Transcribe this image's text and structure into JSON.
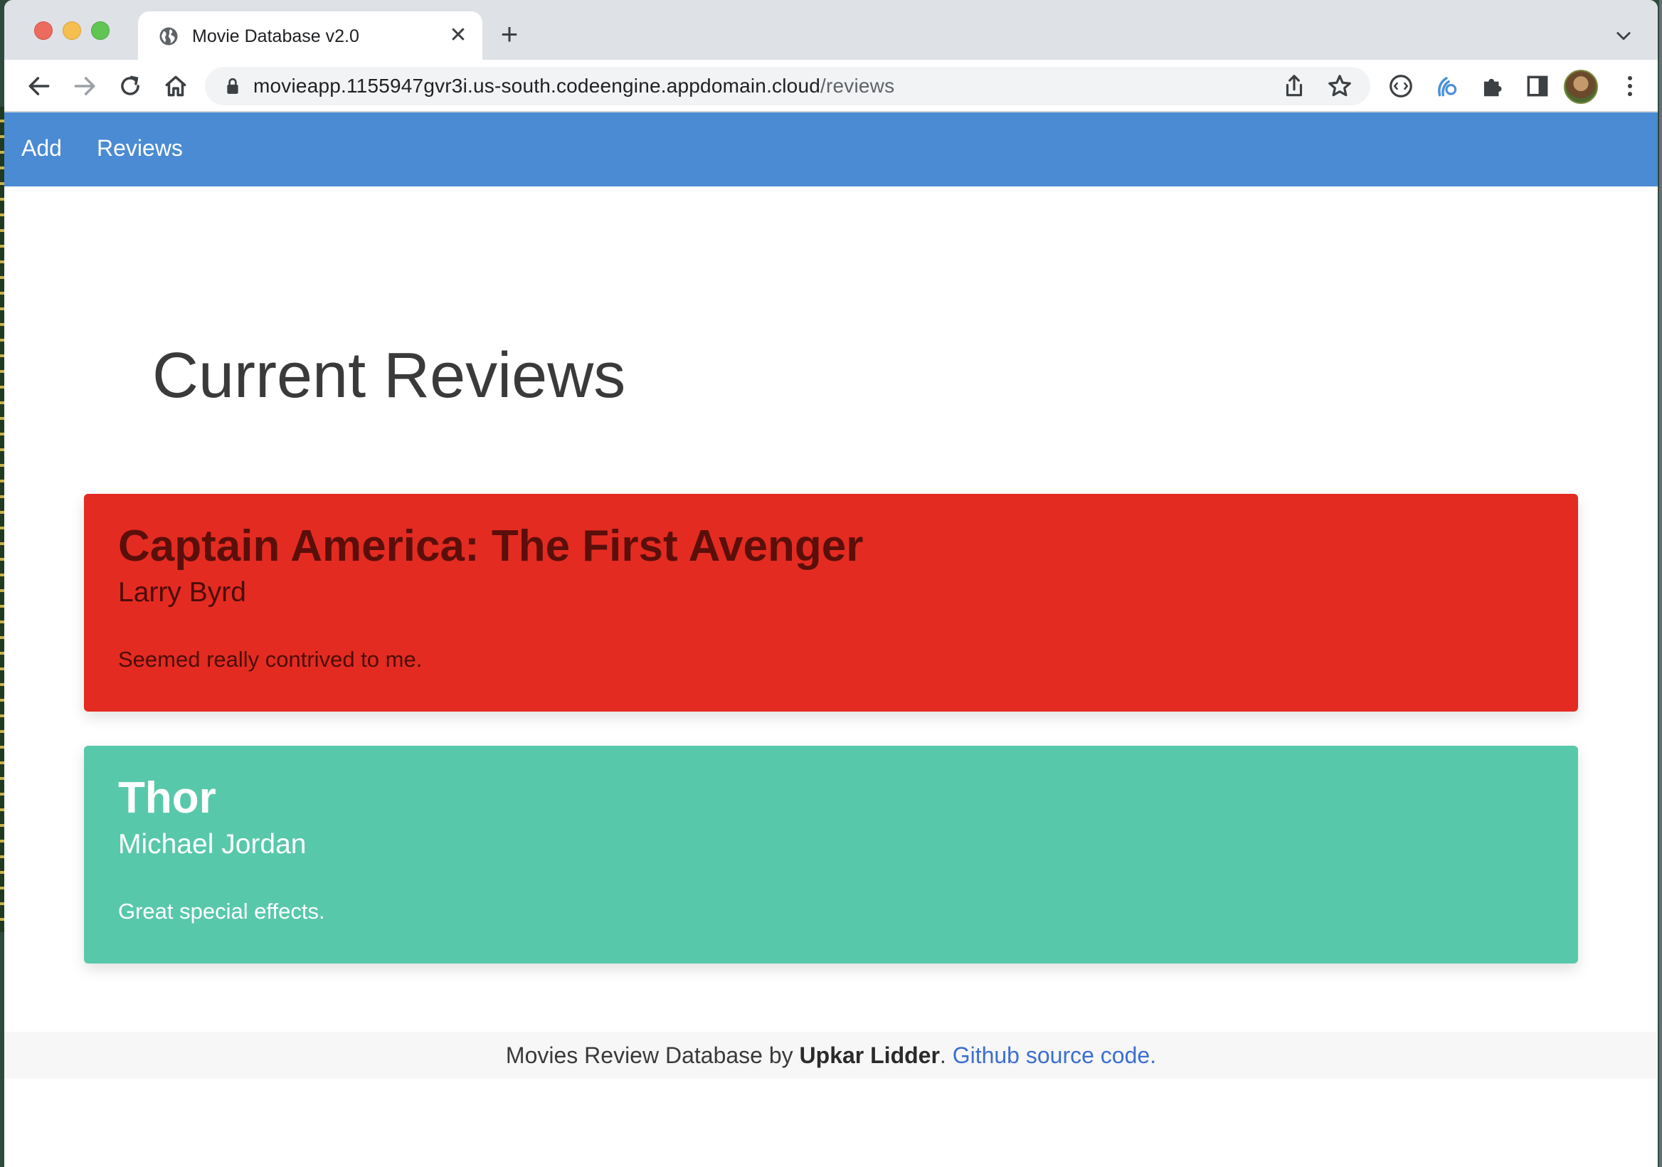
{
  "browser": {
    "tab_title": "Movie Database v2.0",
    "new_tab_label": "+",
    "close_label": "✕",
    "url_host": "movieapp.1155947gvr3i.us-south.codeengine.appdomain.cloud",
    "url_path": "/reviews"
  },
  "nav": {
    "items": [
      {
        "label": "Add"
      },
      {
        "label": "Reviews"
      }
    ]
  },
  "page": {
    "heading": "Current Reviews"
  },
  "reviews": [
    {
      "title": "Captain America: The First Avenger",
      "reviewer": "Larry Byrd",
      "comment": "Seemed really contrived to me.",
      "color": "#e42b21"
    },
    {
      "title": "Thor",
      "reviewer": "Michael Jordan",
      "comment": "Great special effects.",
      "color": "#58c8ab"
    }
  ],
  "footer": {
    "prefix": "Movies Review Database by ",
    "author": "Upkar Lidder",
    "separator": ". ",
    "link_text": "Github source code."
  },
  "colors": {
    "navbar": "#4a8bd4",
    "link": "#3b6fd1"
  }
}
